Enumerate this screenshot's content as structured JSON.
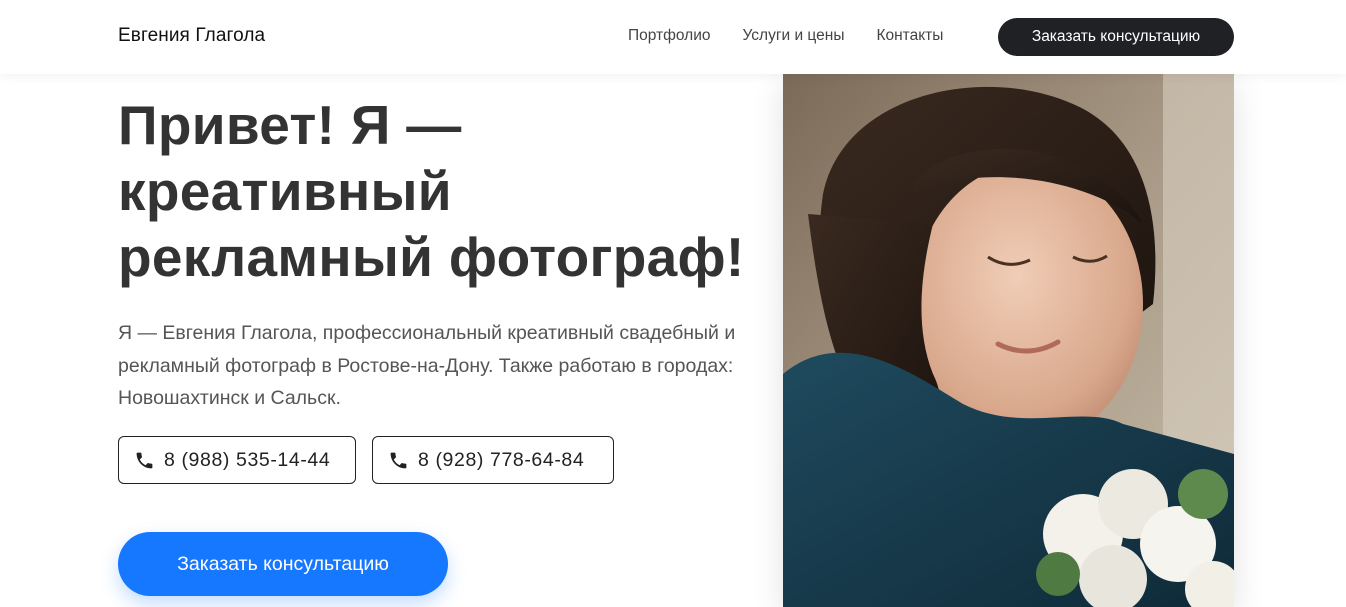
{
  "header": {
    "brand": "Евгения Глагола",
    "nav": [
      "Портфолио",
      "Услуги и цены",
      "Контакты"
    ],
    "cta_label": "Заказать консультацию"
  },
  "hero": {
    "title_lines": [
      "Привет! Я —",
      "креативный",
      "рекламный фотограф!"
    ],
    "description": "Я — Евгения Глагола, профессиональный креативный свадебный и рекламный фотограф в Ростове-на-Дону. Также работаю в городах: Новошахтинск и Сальск.",
    "phones": [
      {
        "icon": "phone-icon",
        "number": "8 (988) 535-14-44"
      },
      {
        "icon": "phone-icon",
        "number": "8 (928) 778-64-84"
      }
    ],
    "cta_label": "Заказать консультацию"
  },
  "colors": {
    "primary_blue": "#1677ff",
    "dark_button": "#1f2125",
    "title_text": "#333333",
    "body_text": "#555555"
  }
}
